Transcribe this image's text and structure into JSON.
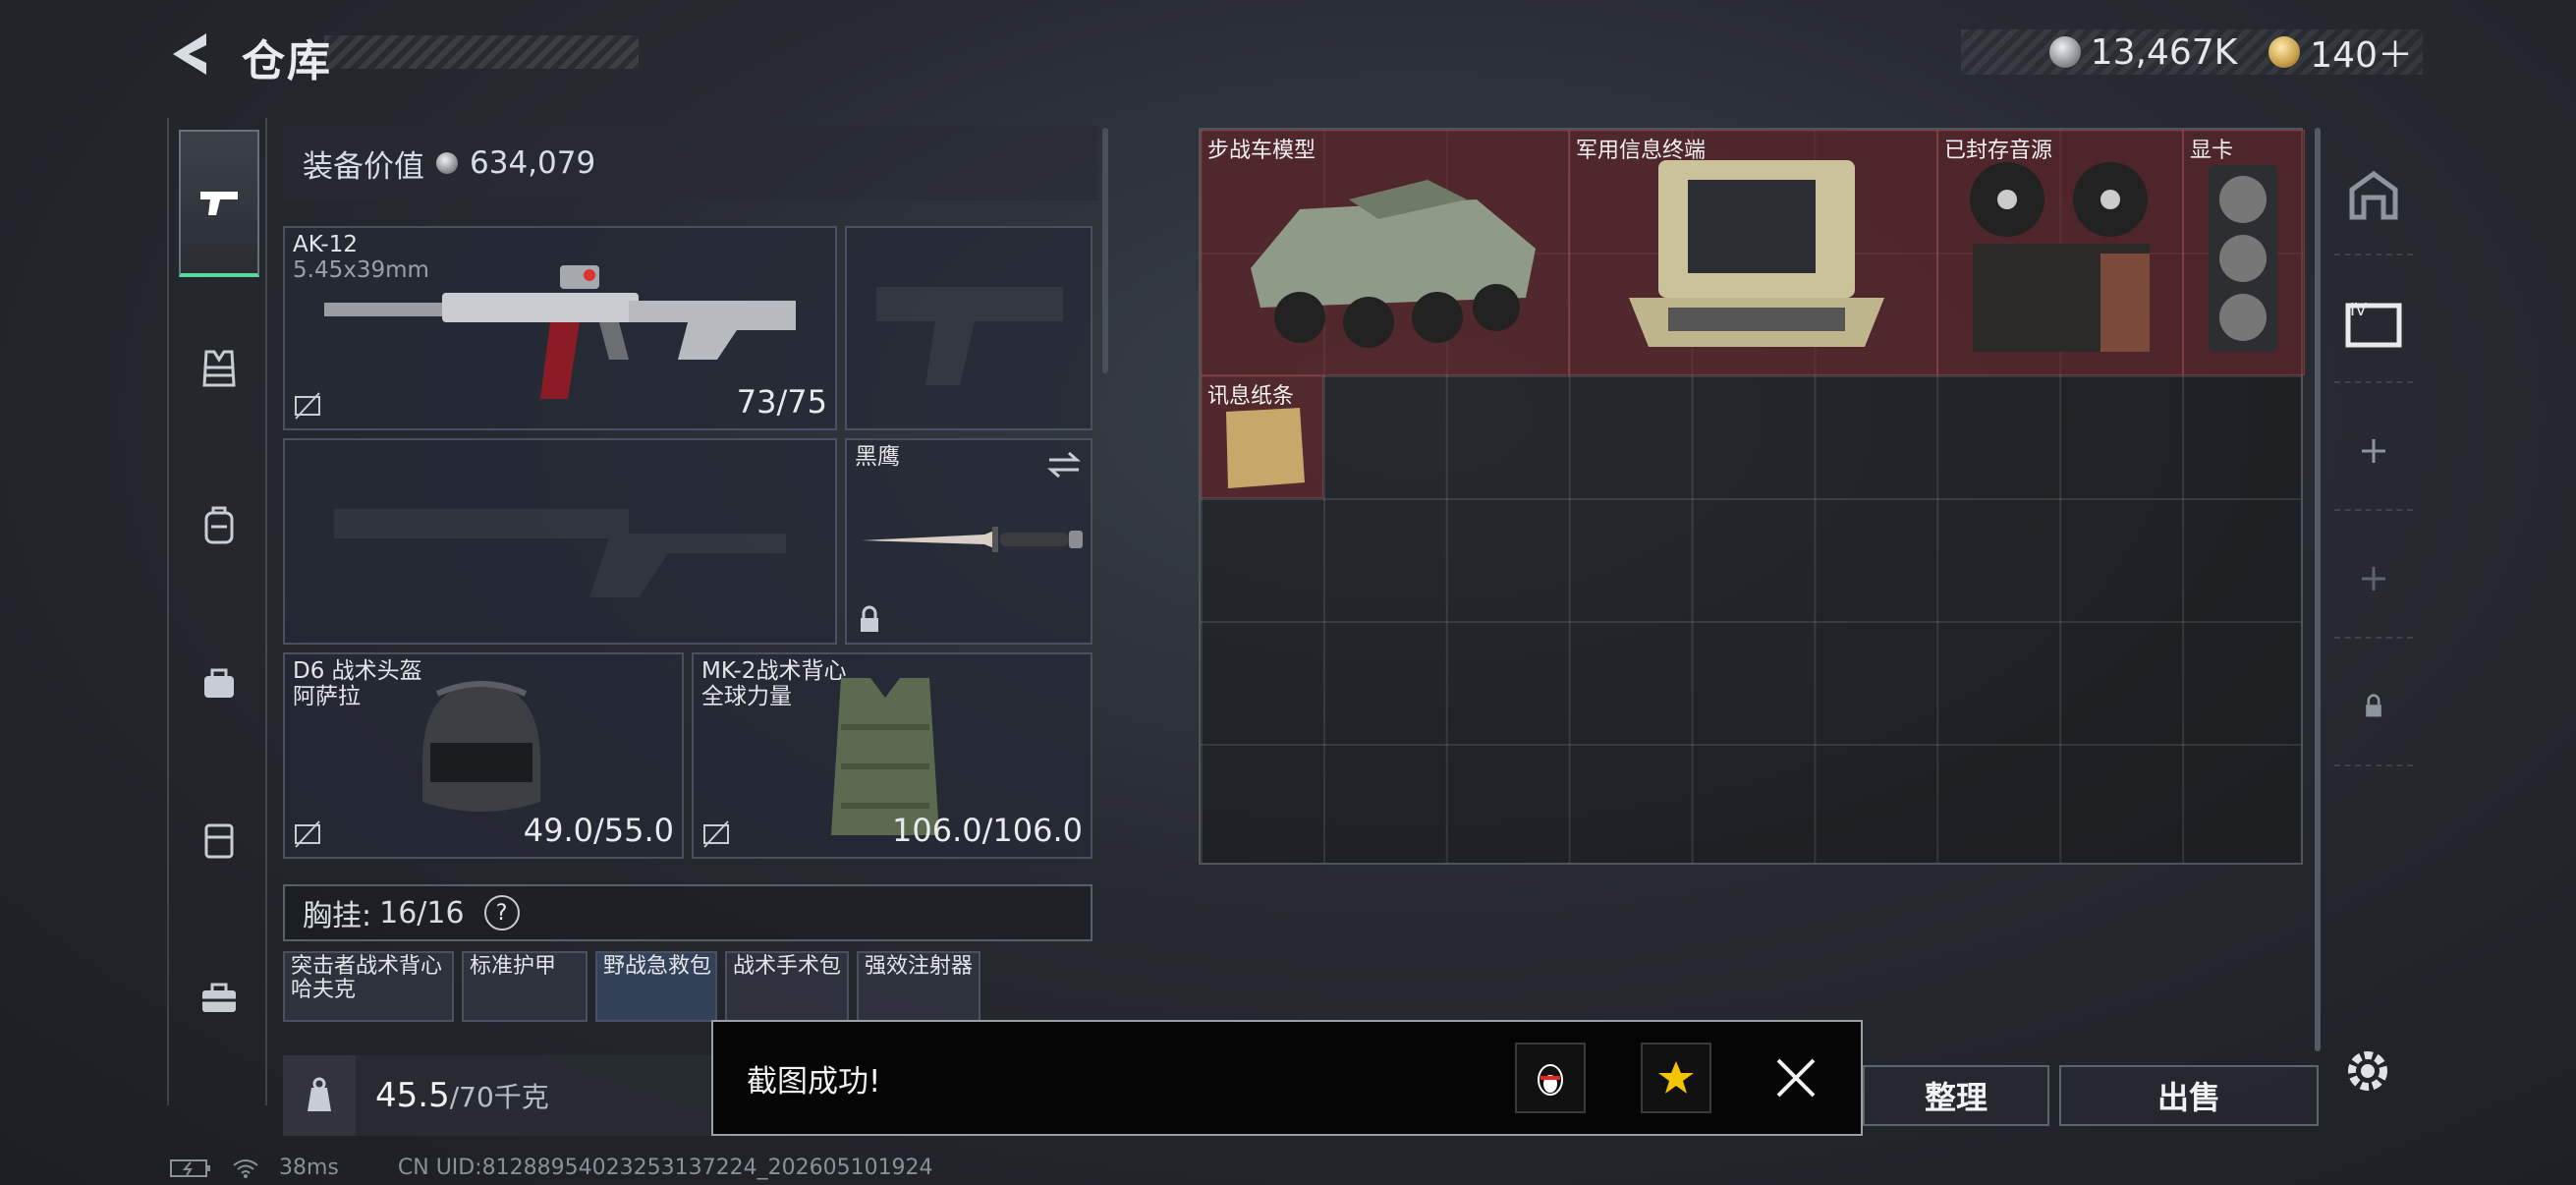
{
  "header": {
    "title": "仓库"
  },
  "currency": {
    "silver": "13,467K",
    "gold": "140＋"
  },
  "equipment": {
    "value_label": "装备价值",
    "value": "634,079",
    "primary_weapon": {
      "name": "AK-12",
      "ammo": "5.45x39mm",
      "durability": "73/75"
    },
    "melee": {
      "name": "黑鹰"
    },
    "helmet": {
      "name": "D6 战术头盔",
      "sub": "阿萨拉",
      "durability": "49.0/55.0"
    },
    "armor": {
      "name": "MK-2战术背心",
      "sub": "全球力量",
      "durability": "106.0/106.0"
    }
  },
  "chest_rig": {
    "label": "胸挂:",
    "count": "16/16",
    "help": "?",
    "items": [
      {
        "label": "突击者战术背心\n哈夫克"
      },
      {
        "label": "标准护甲"
      },
      {
        "label": "野战急救包"
      },
      {
        "label": "战术手术包"
      },
      {
        "label": "强效注射器"
      }
    ]
  },
  "weight": {
    "value": "45.5",
    "max": "/70千克"
  },
  "stash": {
    "items": [
      {
        "label": "步战车模型"
      },
      {
        "label": "军用信息终端"
      },
      {
        "label": "已封存音源"
      },
      {
        "label": "显卡"
      },
      {
        "label": "讯息纸条"
      }
    ]
  },
  "actions": {
    "sort": "整理",
    "sell": "出售"
  },
  "toast": {
    "message": "截图成功!"
  },
  "status": {
    "ping": "38ms",
    "uid": "CN UID:81288954023253137224_202605101924"
  },
  "colors": {
    "accent_green": "#58d6a3",
    "item_highlight": "#762a30"
  }
}
